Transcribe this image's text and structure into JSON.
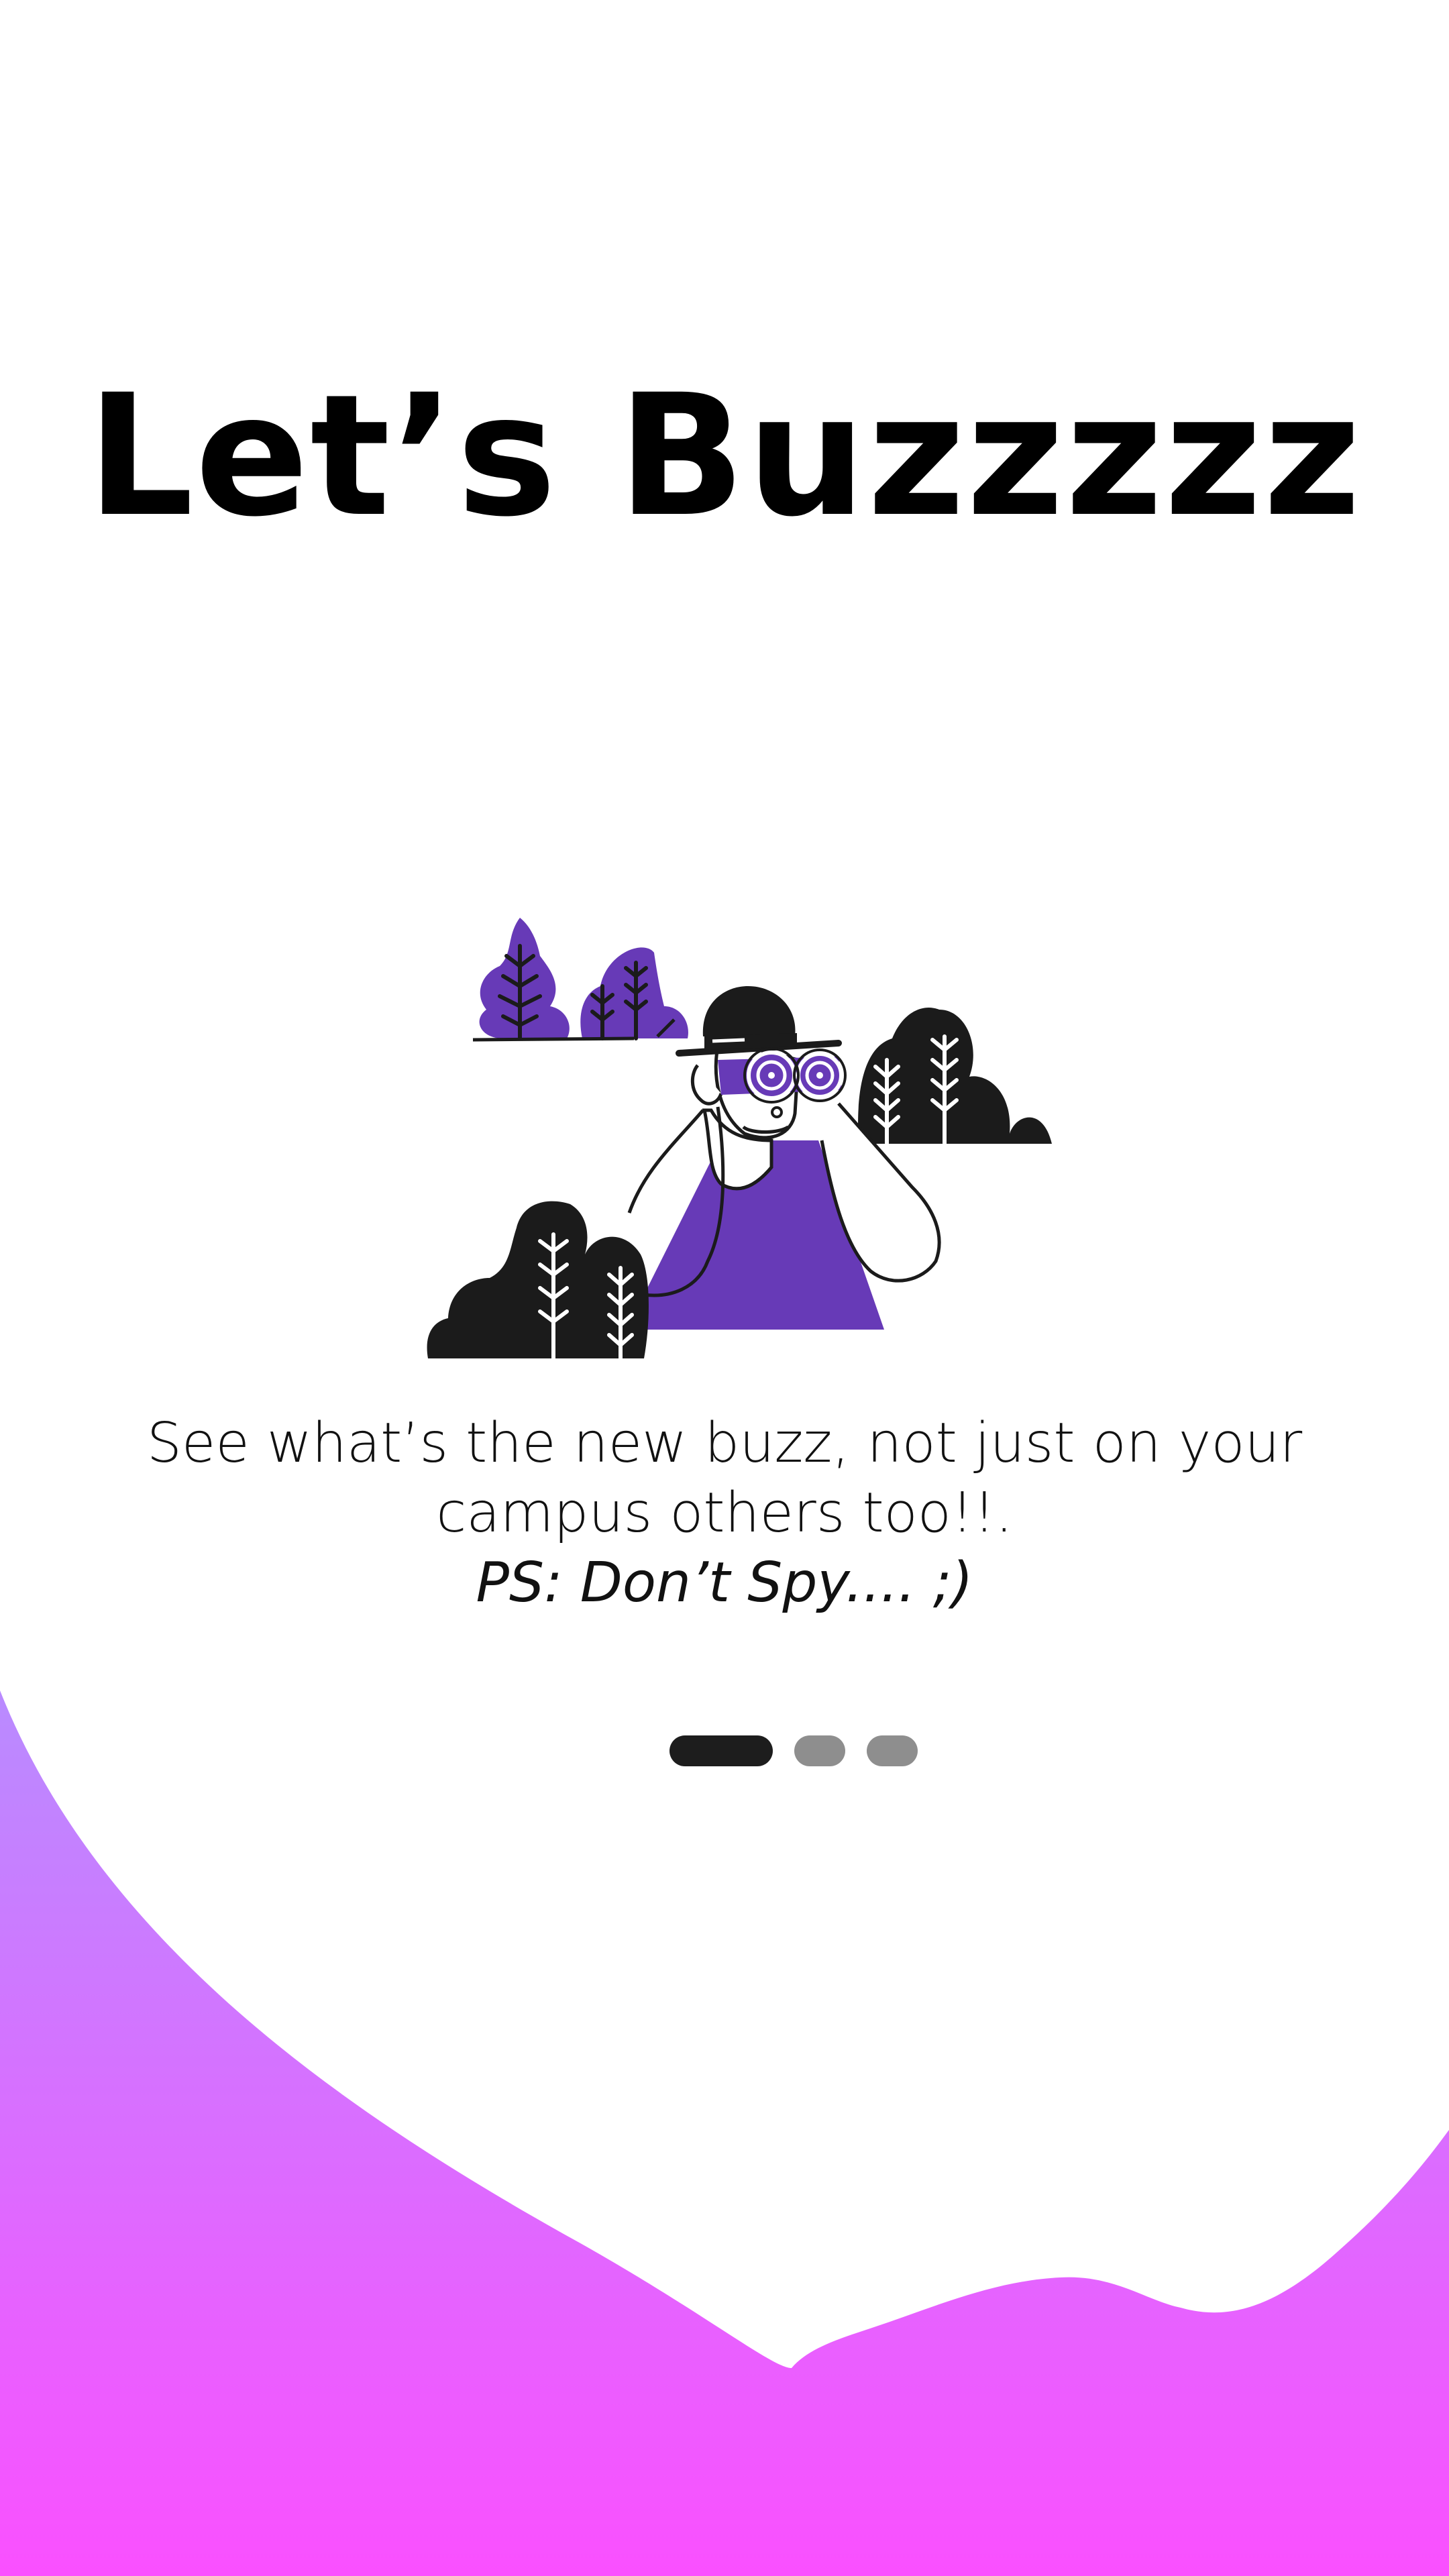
{
  "onboarding": {
    "title": "Let’s Buzzzzz",
    "description_line1": "See what’s the new buzz, not just on your",
    "description_line2": "campus others too!!.",
    "description_ps": "PS: Don’t Spy.... ;)",
    "illustration": "person-with-binoculars-illustration",
    "pager": {
      "total": 3,
      "active_index": 0
    }
  },
  "colors": {
    "background": "#ffffff",
    "text": "#000000",
    "accent_purple": "#673ab7",
    "illustration_dark": "#1b1b1b",
    "wave_gradient_top": "#b98bff",
    "wave_gradient_bottom": "#fa50ff",
    "pager_active": "#1d1d1d",
    "pager_inactive": "#8e8e8e"
  }
}
